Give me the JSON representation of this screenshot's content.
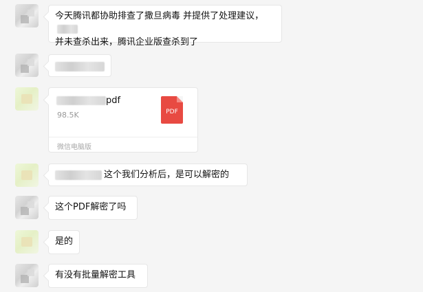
{
  "messages": [
    {
      "line1": "今天腾讯都协助排查了撒旦病毒 并提供了处理建议，",
      "line2": "并未查杀出来，腾讯企业版查杀到了"
    },
    {
      "text": ""
    },
    {
      "file": {
        "name_suffix": "pdf",
        "size": "98.5K",
        "source": "微信电脑版",
        "icon_label": "PDF",
        "icon_color": "#e84a42"
      }
    },
    {
      "text": "这个我们分析后，是可以解密的"
    },
    {
      "text": "这个PDF解密了吗"
    },
    {
      "text": "是的"
    },
    {
      "text": "有没有批量解密工具"
    }
  ],
  "colors": {
    "background": "#f5f5f5",
    "bubble": "#ffffff",
    "pdf_red": "#e84a42"
  }
}
